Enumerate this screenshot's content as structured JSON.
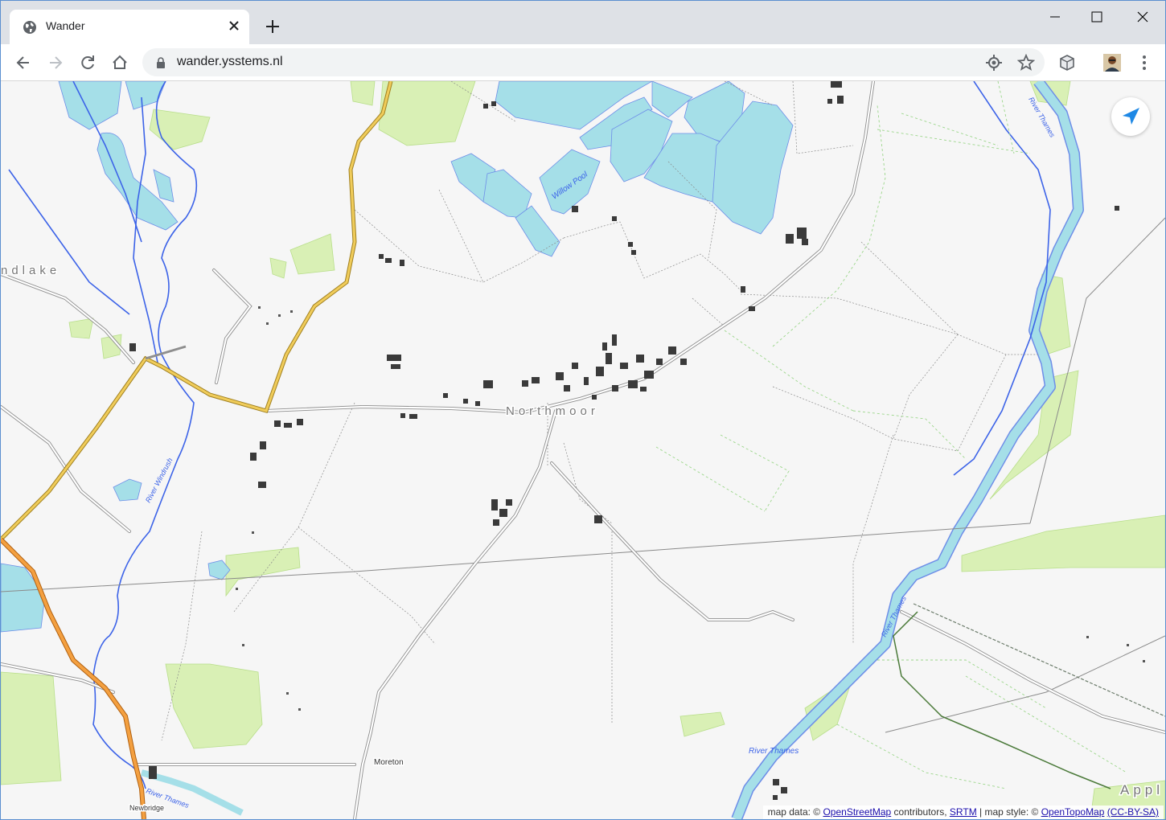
{
  "browser": {
    "tab": {
      "title": "Wander"
    },
    "url": "wander.ysstems.nl"
  },
  "map": {
    "place_labels": {
      "northmoor": "Northmoor",
      "standlake": "ndlake",
      "moreton": "Moreton",
      "newbridge": "Newbridge",
      "appleton": "Appl",
      "willow_pool": "Willow Pool",
      "river_windrush": "River Windrush",
      "river_thames_bottom": "River Thames",
      "river_thames_right": "River Thames",
      "river_thames_center": "River Thames",
      "river_thames_top": "River Thames"
    },
    "attribution": {
      "prefix": "map data: ©",
      "osm": "OpenStreetMap",
      "contributors": "contributors,",
      "srtm": "SRTM",
      "style": "| map style: ©",
      "opentopomap": "OpenTopoMap",
      "license": "(CC-BY-SA)"
    },
    "colors": {
      "water": "#a5dfe8",
      "river": "#3c63e8",
      "woodland": "#d9f0b5",
      "main_road": "#e89734",
      "secondary_road": "#d9b240",
      "building": "#3a3a3a"
    }
  }
}
